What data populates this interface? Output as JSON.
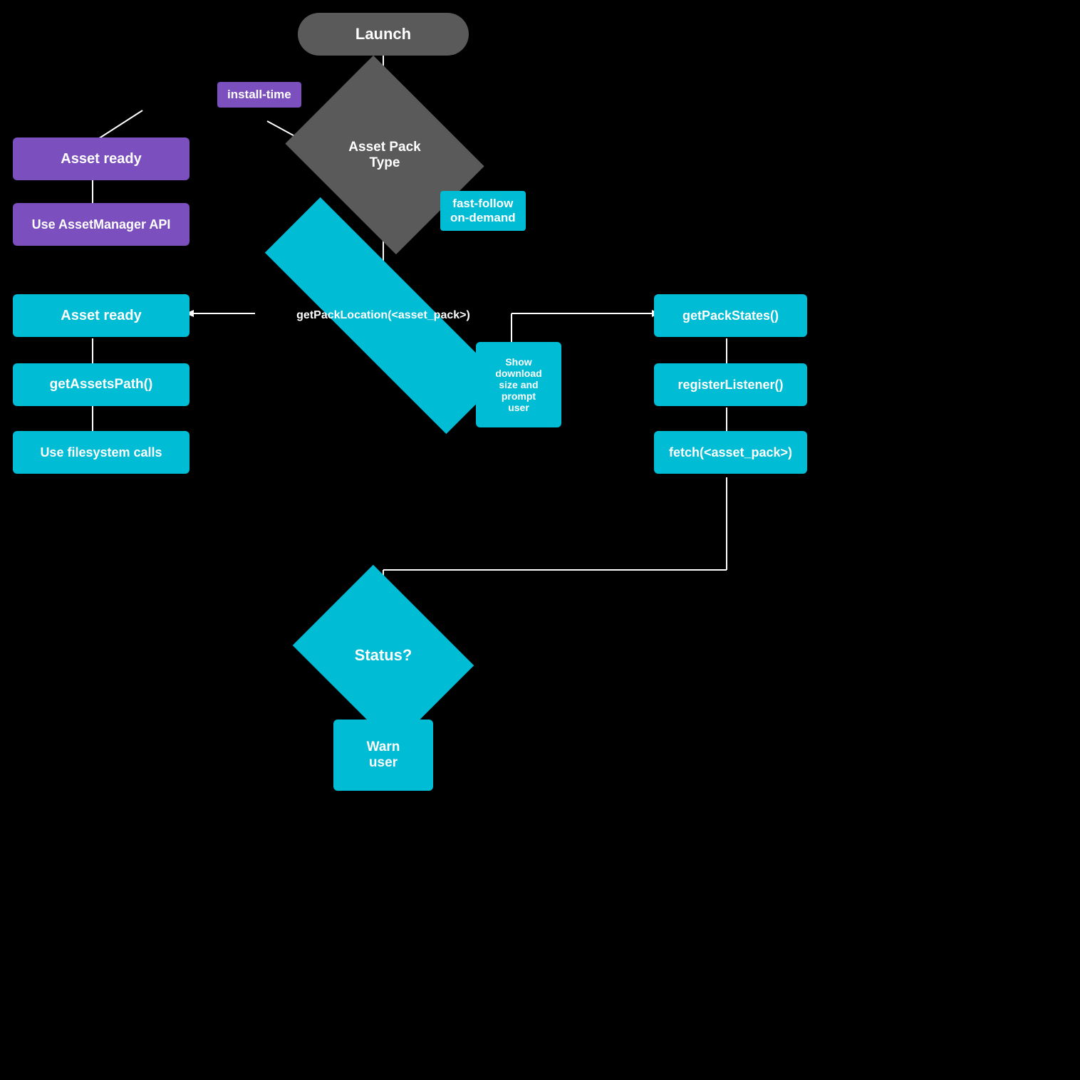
{
  "nodes": {
    "launch": {
      "label": "Launch"
    },
    "assetPackType": {
      "label": "Asset Pack\nType"
    },
    "installTime": {
      "label": "install-time"
    },
    "fastFollow": {
      "label": "fast-follow\non-demand"
    },
    "assetReady1": {
      "label": "Asset ready"
    },
    "useAssetManagerAPI": {
      "label": "Use AssetManager API"
    },
    "assetReady2": {
      "label": "Asset ready"
    },
    "getAssetsPath": {
      "label": "getAssetsPath()"
    },
    "useFilesystem": {
      "label": "Use filesystem calls"
    },
    "getPackLocation": {
      "label": "getPackLocation(<asset_pack>)"
    },
    "showDownload": {
      "label": "Show\ndownload\nsize and\nprompt\nuser"
    },
    "getPackStates": {
      "label": "getPackStates()"
    },
    "registerListener": {
      "label": "registerListener()"
    },
    "fetchAssetPack": {
      "label": "fetch(<asset_pack>)"
    },
    "status": {
      "label": "Status?"
    },
    "warnUser": {
      "label": "Warn\nuser"
    }
  }
}
